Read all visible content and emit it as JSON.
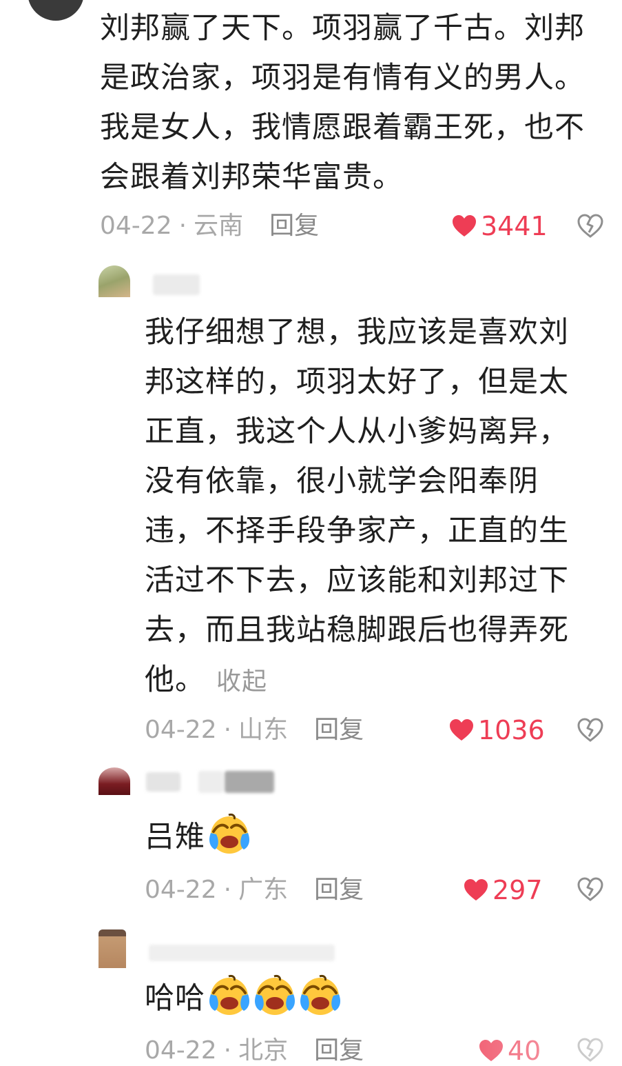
{
  "comments": [
    {
      "text_lines": [
        "刘邦赢了天下。项羽赢了千古。刘邦",
        "是政治家，项羽是有情有义的男人。",
        "我是女人，我情愿跟着霸王死，也不",
        "会跟着刘邦荣华富贵。"
      ],
      "date": "04-22",
      "location": "云南",
      "reply_label": "回复",
      "likes": "3441"
    },
    {
      "text_lines": [
        "我仔细想了想，我应该是喜欢刘",
        "邦这样的，项羽太好了，但是太",
        "正直，我这个人从小爹妈离异，",
        "没有依靠，很小就学会阳奉阴",
        "违，不择手段争家产，正直的生",
        "活过不下去，应该能和刘邦过下",
        "去，而且我站稳脚跟后也得弄死",
        "他。"
      ],
      "collapse_label": "收起",
      "date": "04-22",
      "location": "山东",
      "reply_label": "回复",
      "likes": "1036"
    },
    {
      "text": "吕雉",
      "emoji": "laugh-cry-emoji",
      "date": "04-22",
      "location": "广东",
      "reply_label": "回复",
      "likes": "297"
    },
    {
      "text": "哈哈",
      "emoji_count": 3,
      "date": "04-22",
      "location": "北京",
      "reply_label": "回复",
      "likes": "40"
    }
  ],
  "colors": {
    "like": "#ee3d55",
    "meta": "#a8a8a8",
    "text": "#1f1f1f"
  }
}
